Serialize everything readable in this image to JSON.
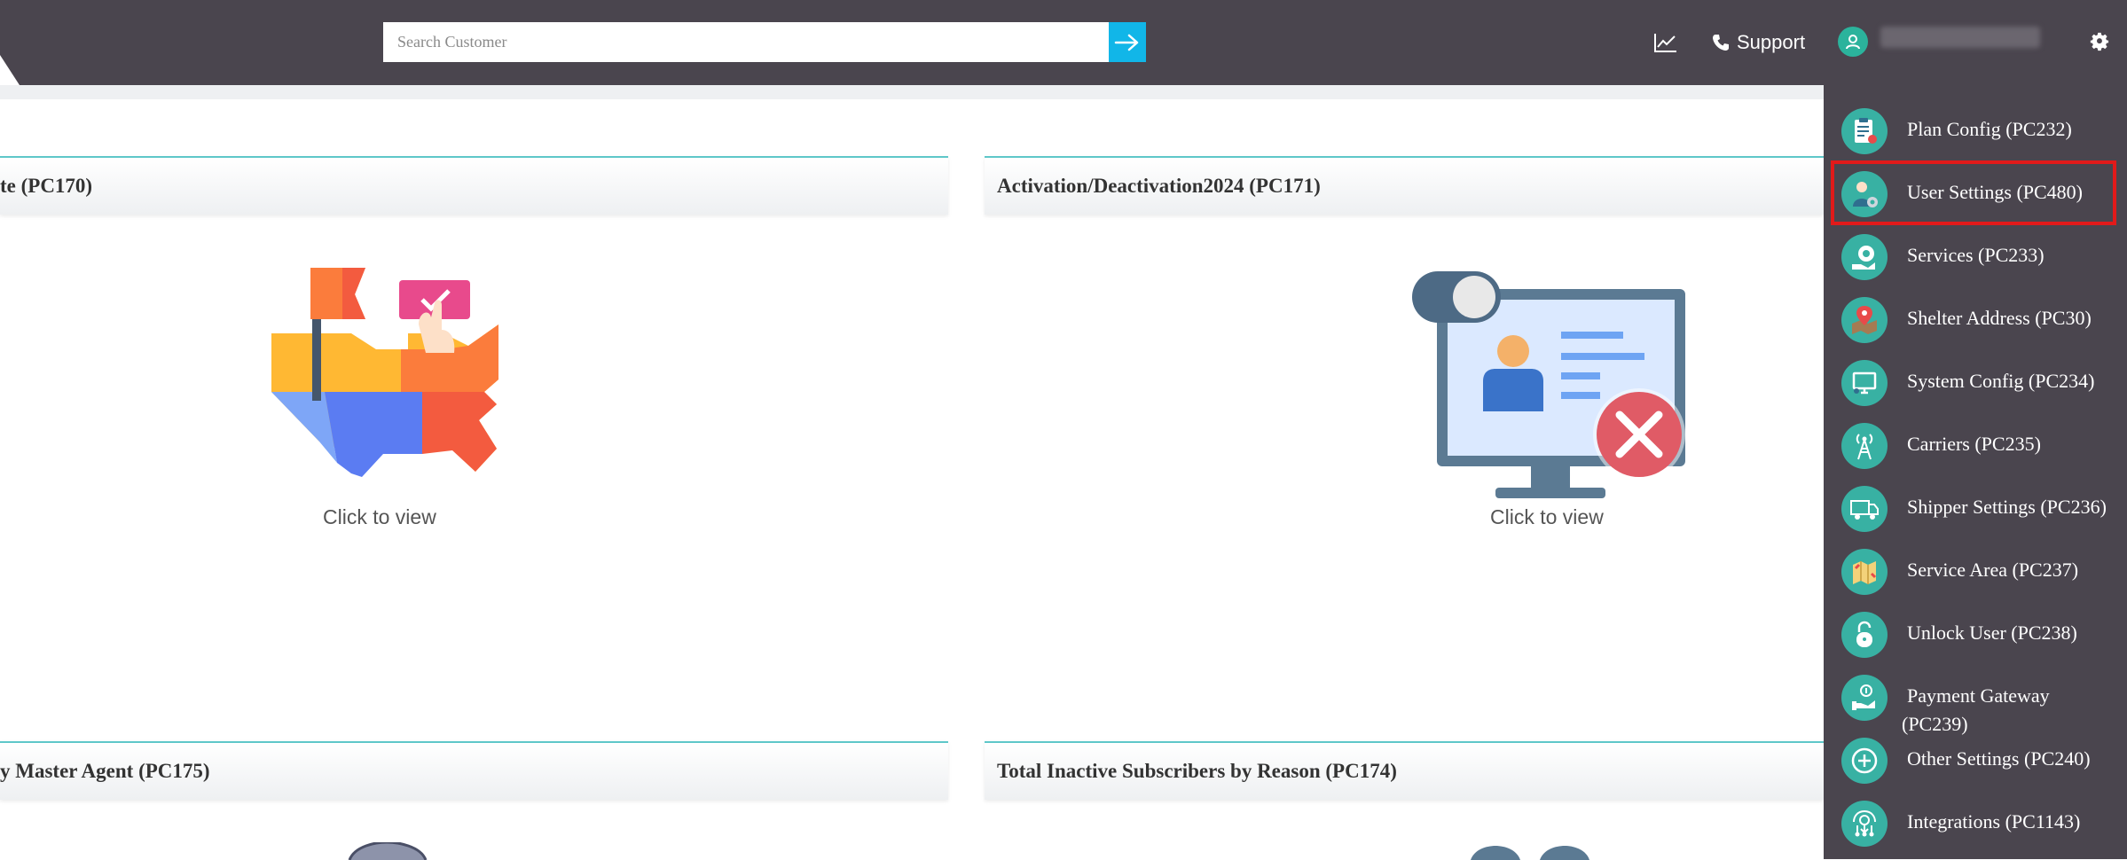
{
  "search": {
    "placeholder": "Search Customer"
  },
  "header": {
    "support_label": "Support"
  },
  "panels": [
    {
      "title": "te (PC170)",
      "cta": "Click to view"
    },
    {
      "title": "Activation/Deactivation2024 (PC171)",
      "cta": "Click to view"
    },
    {
      "title": "y Master Agent (PC175)"
    },
    {
      "title": "Total Inactive Subscribers by Reason (PC174)"
    }
  ],
  "sidebar": {
    "items": [
      {
        "label": "Plan Config (PC232)",
        "icon": "clipboard-icon"
      },
      {
        "label": "User Settings (PC480)",
        "icon": "user-gear-icon",
        "highlighted": true
      },
      {
        "label": "Services (PC233)",
        "icon": "hand-gear-icon"
      },
      {
        "label": "Shelter Address (PC30)",
        "icon": "map-pin-icon"
      },
      {
        "label": "System Config (PC234)",
        "icon": "monitor-icon"
      },
      {
        "label": "Carriers (PC235)",
        "icon": "antenna-tower-icon"
      },
      {
        "label": "Shipper Settings (PC236)",
        "icon": "truck-icon"
      },
      {
        "label": "Service Area (PC237)",
        "icon": "area-map-icon"
      },
      {
        "label": "Unlock User (PC238)",
        "icon": "unlock-icon"
      },
      {
        "label": "Payment Gateway (PC239)",
        "icon": "payment-hand-icon"
      },
      {
        "label": "Other Settings (PC240)",
        "icon": "plus-circle-icon"
      },
      {
        "label": "Integrations (PC1143)",
        "icon": "network-icon"
      }
    ]
  },
  "colors": {
    "topbar": "#4a454e",
    "accent_teal": "#38b1a3",
    "search_button": "#11b6e8",
    "highlight_border": "#e21a1a"
  }
}
